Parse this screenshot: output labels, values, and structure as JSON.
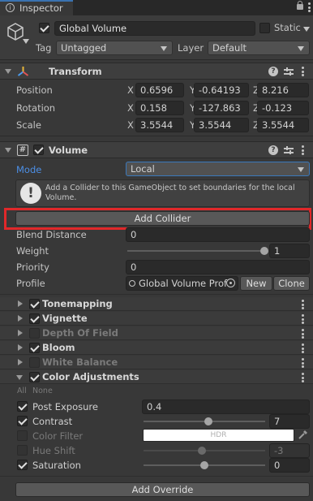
{
  "window": {
    "tab_title": "Inspector"
  },
  "gameobject": {
    "name": "Global Volume",
    "static_label": "Static",
    "tag_label": "Tag",
    "tag_value": "Untagged",
    "layer_label": "Layer",
    "layer_value": "Default"
  },
  "transform": {
    "title": "Transform",
    "rows": [
      {
        "label": "Position",
        "x": "0.6596",
        "y": "-0.64193",
        "z": "8.216"
      },
      {
        "label": "Rotation",
        "x": "0.158",
        "y": "-127.863",
        "z": "-0.123"
      },
      {
        "label": "Scale",
        "x": "3.5544",
        "y": "3.5544",
        "z": "3.5544"
      }
    ],
    "axis": {
      "x": "X",
      "y": "Y",
      "z": "Z"
    }
  },
  "volume": {
    "title": "Volume",
    "mode_label": "Mode",
    "mode_value": "Local",
    "help_text": "Add a Collider to this GameObject to set boundaries for the local Volume.",
    "add_collider": "Add Collider",
    "blend_label": "Blend Distance",
    "blend_value": "0",
    "weight_label": "Weight",
    "weight_value": "1",
    "weight_fraction": 1.0,
    "priority_label": "Priority",
    "priority_value": "0",
    "profile_label": "Profile",
    "profile_value": "Global Volume Prof",
    "new_button": "New",
    "clone_button": "Clone"
  },
  "overrides": [
    {
      "name": "Tonemapping",
      "checked": true,
      "enabled": true
    },
    {
      "name": "Vignette",
      "checked": true,
      "enabled": true
    },
    {
      "name": "Depth Of Field",
      "checked": false,
      "enabled": false
    },
    {
      "name": "Bloom",
      "checked": true,
      "enabled": true
    },
    {
      "name": "White Balance",
      "checked": false,
      "enabled": false
    },
    {
      "name": "Color Adjustments",
      "checked": true,
      "enabled": true
    }
  ],
  "color_adjustments": {
    "all_label": "All",
    "none_label": "None",
    "post_exposure_label": "Post Exposure",
    "post_exposure_value": "0.4",
    "contrast_label": "Contrast",
    "contrast_value": "7",
    "color_filter_label": "Color Filter",
    "color_filter_hdr": "HDR",
    "hue_shift_label": "Hue Shift",
    "hue_shift_value": "-3",
    "saturation_label": "Saturation",
    "saturation_value": "0"
  },
  "add_override": "Add Override",
  "colors": {
    "highlight": "#e0282a",
    "mode_label": "#4c8fe6",
    "field_bg": "#2a2a2a"
  },
  "icons": [
    "lock-icon",
    "kebab-icon",
    "cube-icon",
    "transform-icon",
    "script-icon",
    "help-icon",
    "preset-icon",
    "warning-icon",
    "object-picker-icon",
    "eyedropper-icon"
  ]
}
